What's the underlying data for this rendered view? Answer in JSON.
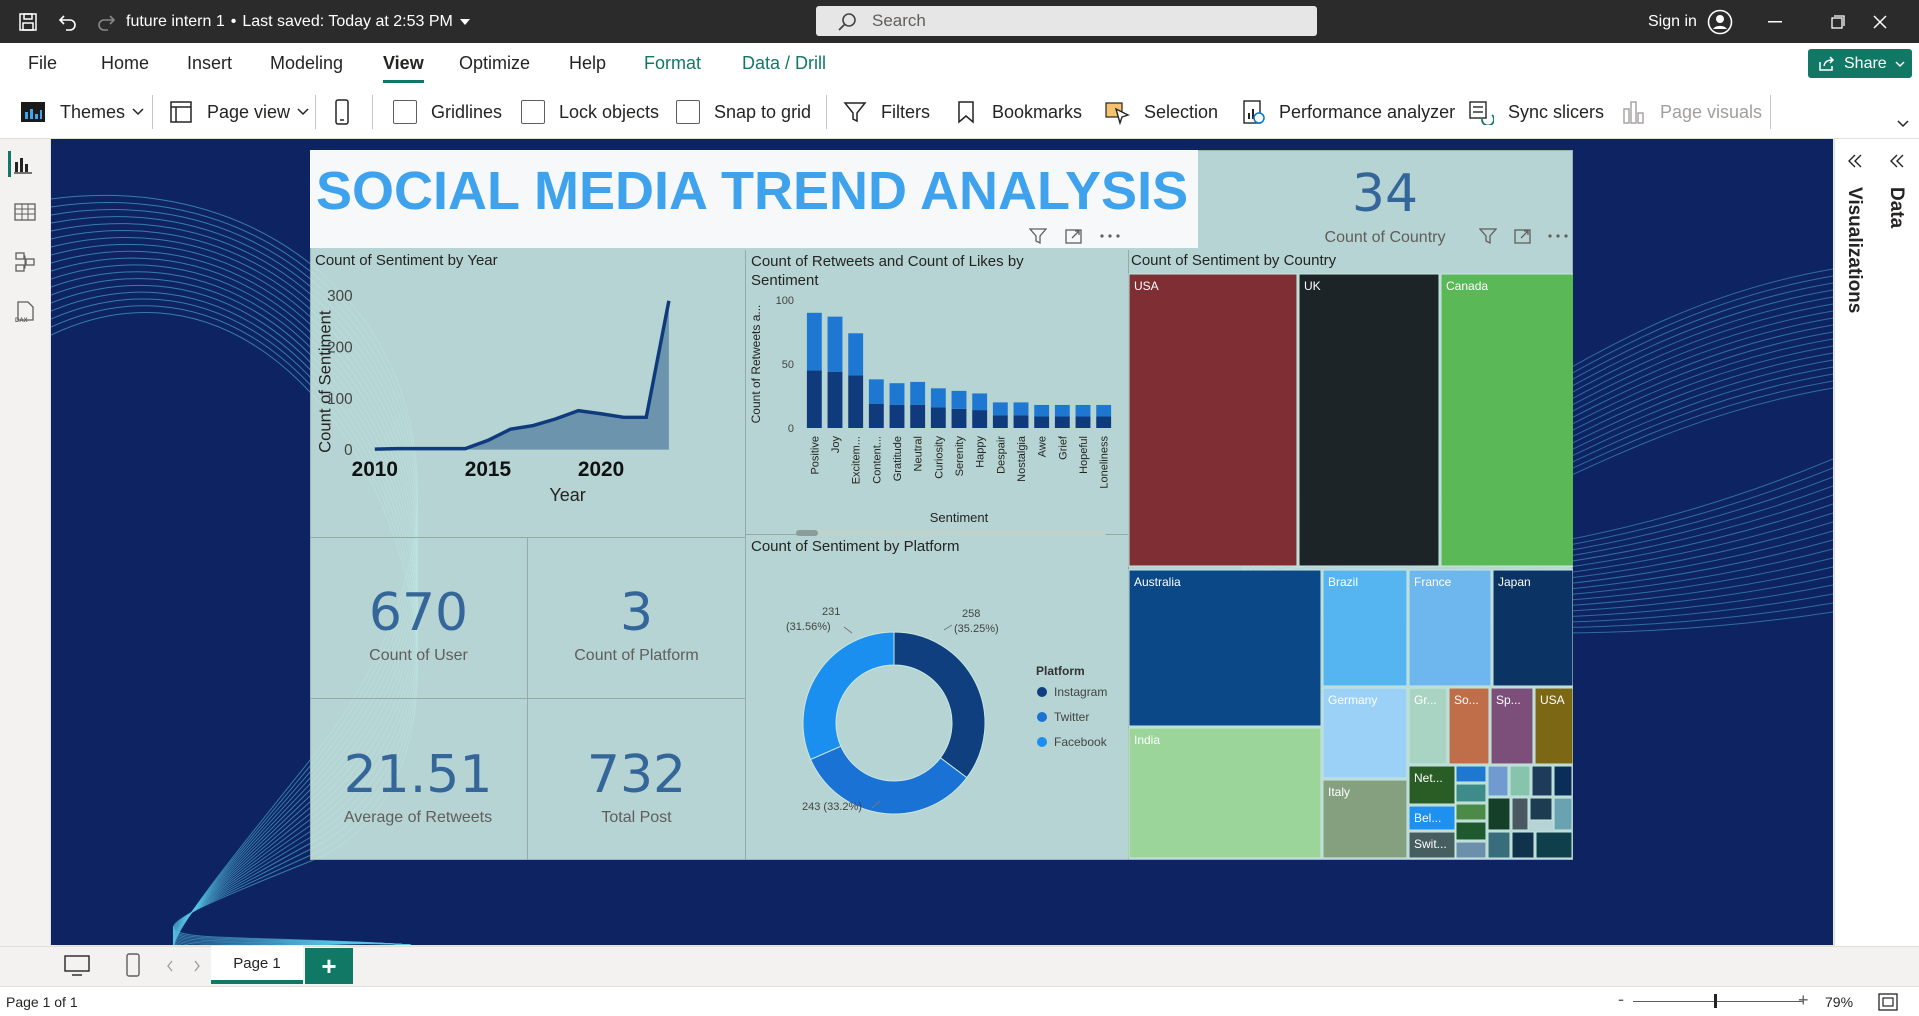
{
  "titlebar": {
    "doc_title": "future intern 1",
    "saved_status": "Last saved: Today at 2:53 PM",
    "search_placeholder": "Search",
    "sign_in": "Sign in"
  },
  "menu": {
    "file": "File",
    "home": "Home",
    "insert": "Insert",
    "modeling": "Modeling",
    "view": "View",
    "optimize": "Optimize",
    "help": "Help",
    "format": "Format",
    "data_drill": "Data / Drill",
    "share": "Share"
  },
  "ribbon": {
    "themes": "Themes",
    "page_view": "Page view",
    "gridlines": "Gridlines",
    "lock_objects": "Lock objects",
    "snap_to_grid": "Snap to grid",
    "filters": "Filters",
    "bookmarks": "Bookmarks",
    "selection": "Selection",
    "performance_analyzer": "Performance analyzer",
    "sync_slicers": "Sync slicers",
    "page_visuals": "Page visuals"
  },
  "panes": {
    "visualizations": "Visualizations",
    "data": "Data"
  },
  "report": {
    "title": "SOCIAL MEDIA TREND ANALYSIS",
    "kpis": {
      "country": {
        "value": "34",
        "label": "Count of Country"
      },
      "user": {
        "value": "670",
        "label": "Count of User"
      },
      "platform": {
        "value": "3",
        "label": "Count of Platform"
      },
      "retweets": {
        "value": "21.51",
        "label": "Average of Retweets"
      },
      "posts": {
        "value": "732",
        "label": "Total Post"
      }
    }
  },
  "chart_data": [
    {
      "type": "area",
      "title": "Count of Sentiment by Year",
      "xlabel": "Year",
      "ylabel": "Count of Sentiment",
      "x": [
        2010,
        2011,
        2012,
        2013,
        2014,
        2015,
        2016,
        2017,
        2018,
        2019,
        2020,
        2021,
        2022,
        2023
      ],
      "values": [
        1,
        2,
        2,
        2,
        2,
        18,
        40,
        47,
        60,
        76,
        70,
        63,
        63,
        290
      ],
      "ylim": [
        0,
        300
      ],
      "yticks": [
        "0",
        "100",
        "200",
        "300"
      ],
      "xticks": [
        "2010",
        "2015",
        "2020"
      ],
      "colors": {
        "line": "#0f3b7d",
        "fill": "#5f8aa6"
      }
    },
    {
      "type": "bar",
      "title": "Count of Retweets and Count of Likes by Sentiment",
      "xlabel": "Sentiment",
      "ylabel": "Count of Retweets a...",
      "categories": [
        "Positive",
        "Joy",
        "Excitem...",
        "Content...",
        "Gratitude",
        "Neutral",
        "Curiosity",
        "Serenity",
        "Happy",
        "Despair",
        "Nostalgia",
        "Awe",
        "Grief",
        "Hopeful",
        "Loneliness"
      ],
      "series": [
        {
          "values": [
            45,
            44,
            41,
            19,
            18,
            18,
            16,
            15,
            14,
            10,
            10,
            9,
            9,
            9,
            9
          ],
          "color": "#0f3b7d"
        },
        {
          "values": [
            45,
            43,
            33,
            19,
            17,
            18,
            15,
            14,
            13,
            10,
            10,
            9,
            9,
            9,
            9
          ],
          "color": "#1e78d2"
        }
      ],
      "ylim": [
        0,
        100
      ],
      "yticks": [
        "0",
        "50",
        "100"
      ]
    },
    {
      "type": "pie",
      "title": "Count of Sentiment by Platform",
      "legend_title": "Platform",
      "slices": [
        {
          "name": "Instagram",
          "value": 258,
          "label": "258",
          "pct": "(35.25%)",
          "color": "#0f3f7e"
        },
        {
          "name": "Twitter",
          "value": 243,
          "label": "243 (33.2%)",
          "pct": "",
          "color": "#1a72d4"
        },
        {
          "name": "Facebook",
          "value": 231,
          "label": "231",
          "pct": "(31.56%)",
          "color": "#1b8ff0"
        }
      ]
    },
    {
      "type": "treemap",
      "title": "Count of Sentiment by Country",
      "labels": [
        "USA",
        "UK",
        "Canada",
        "Australia",
        "Brazil",
        "France",
        "Japan",
        "India",
        "Germany",
        "Gr...",
        "So...",
        "Sp...",
        "USA",
        "Italy",
        "Net...",
        "Bel...",
        "Swit..."
      ],
      "colors": [
        "#7f2f33",
        "#1d2428",
        "#5ab857",
        "#0a4887",
        "#55b5f1",
        "#6db7ee",
        "#0b3363",
        "#9bd59a",
        "#9bd1f7",
        "#a9d4c4",
        "#c06e4a",
        "#7b4f7a",
        "#7c6714",
        "#84a07f",
        "#2a5d26",
        "#1e90f0",
        "#475e61"
      ]
    }
  ]
}
